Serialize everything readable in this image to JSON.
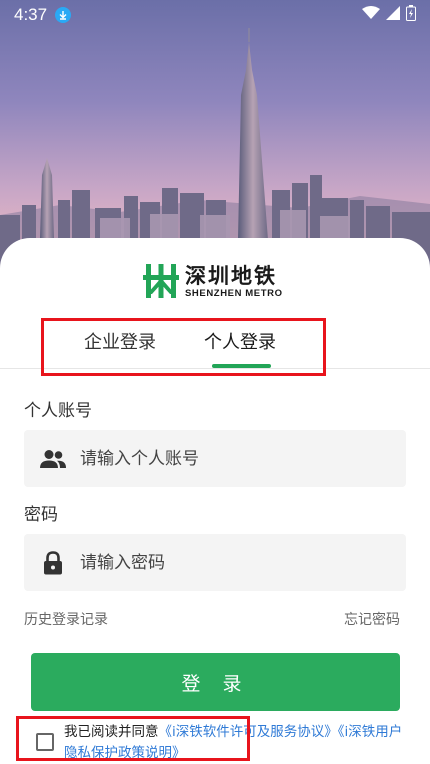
{
  "status_bar": {
    "time": "4:37",
    "icons": [
      "download-icon",
      "wifi-icon",
      "signal-icon",
      "battery-icon"
    ]
  },
  "brand": {
    "name_cn": "深圳地铁",
    "name_en": "SHENZHEN METRO",
    "color": "#22a557"
  },
  "tabs": [
    {
      "label": "企业登录",
      "active": false
    },
    {
      "label": "个人登录",
      "active": true
    }
  ],
  "account": {
    "label": "个人账号",
    "placeholder": "请输入个人账号",
    "icon": "users-icon"
  },
  "password": {
    "label": "密码",
    "placeholder": "请输入密码",
    "icon": "lock-icon"
  },
  "links": {
    "history": "历史登录记录",
    "forgot": "忘记密码"
  },
  "login_button": "登 录",
  "agreement": {
    "prefix": "我已阅读并同意",
    "license_link": "《i深铁软件许可及服务协议》",
    "privacy_link": "《i深铁用户隐私保护政策说明》",
    "checked": false
  },
  "colors": {
    "accent": "#2bab5e",
    "link": "#2f7ad6",
    "annotation": "#e8141c"
  }
}
